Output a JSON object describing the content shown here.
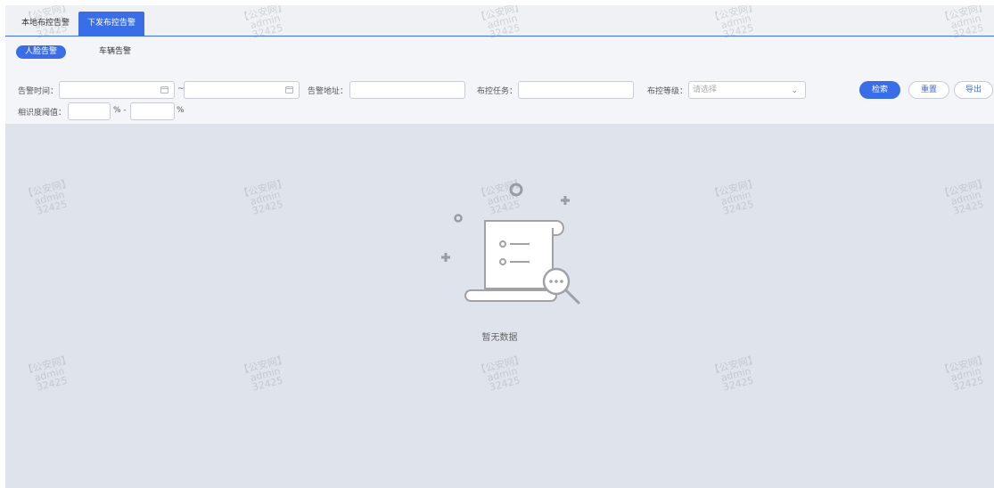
{
  "tabs": [
    {
      "label": "本地布控告警",
      "active": false
    },
    {
      "label": "下发布控告警",
      "active": true
    }
  ],
  "subtabs": [
    {
      "label": "人脸告警",
      "active": true
    },
    {
      "label": "车辆告警",
      "active": false
    }
  ],
  "filters": {
    "alarm_time_label": "告警时间：",
    "range_separator": "~",
    "alarm_address_label": "告警地址：",
    "control_task_label": "布控任务：",
    "control_level_label": "布控等级：",
    "control_level_placeholder": "请选择",
    "similarity_label": "相识度阈值：",
    "percent_dash": "% -",
    "percent": "%"
  },
  "buttons": {
    "search": "检索",
    "reset": "重置",
    "export": "导出"
  },
  "empty": {
    "text": "暂无数据"
  },
  "watermark": {
    "line1": "【公安网】",
    "line2": "admin",
    "line3": "32425"
  },
  "colors": {
    "accent": "#3a6ee8",
    "background": "#dfe3ec"
  }
}
